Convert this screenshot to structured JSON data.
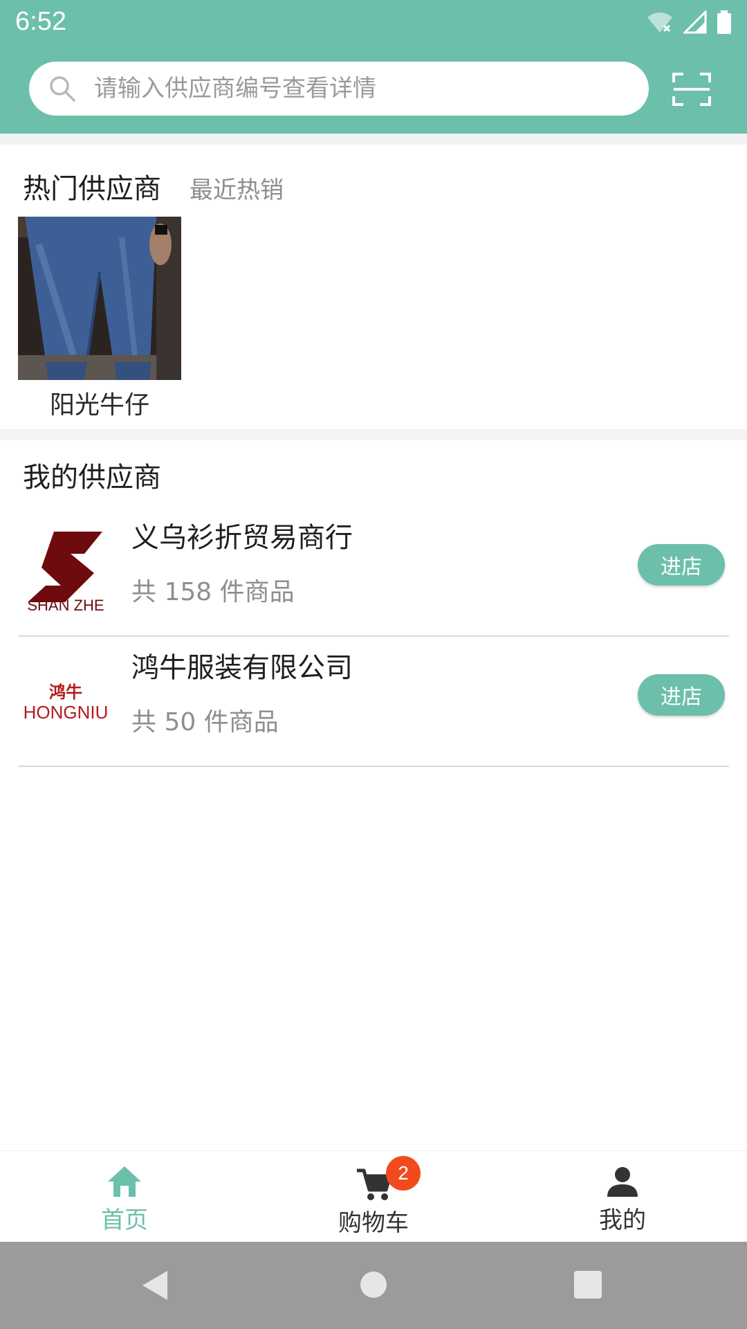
{
  "status_bar": {
    "time": "6:52"
  },
  "search": {
    "placeholder": "请输入供应商编号查看详情"
  },
  "hot_section": {
    "title": "热门供应商",
    "subtitle": "最近热销",
    "items": [
      {
        "name": "阳光牛仔",
        "image": "jeans-photo"
      }
    ]
  },
  "my_section": {
    "title": "我的供应商",
    "suppliers": [
      {
        "name": "义乌衫折贸易商行",
        "count": "共 158 件商品",
        "logo_text": "SHAN ZHE",
        "button": "进店"
      },
      {
        "name": "鸿牛服装有限公司",
        "count": "共 50 件商品",
        "logo_text_cn": "鸿牛",
        "logo_text": "HONGNIU",
        "button": "进店"
      }
    ]
  },
  "bottom_nav": {
    "items": [
      {
        "label": "首页",
        "icon": "home-icon",
        "active": true
      },
      {
        "label": "购物车",
        "icon": "cart-icon",
        "badge": "2"
      },
      {
        "label": "我的",
        "icon": "person-icon"
      }
    ]
  },
  "colors": {
    "accent": "#6cbfab",
    "badge": "#f24a1d",
    "logo_red": "#6d0b0f"
  }
}
